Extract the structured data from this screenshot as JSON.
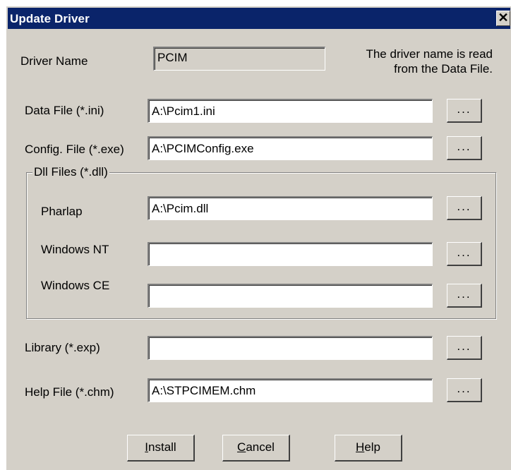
{
  "window": {
    "title": "Update Driver",
    "close_glyph": "✕"
  },
  "driver_name": {
    "label": "Driver Name",
    "value": "PCIM",
    "note_line1": "The driver name is read",
    "note_line2": "from the Data File."
  },
  "data_file": {
    "label": "Data File (*.ini)",
    "value": "A:\\Pcim1.ini"
  },
  "config_file": {
    "label": "Config. File (*.exe)",
    "value": "A:\\PCIMConfig.exe"
  },
  "dll_group": {
    "legend": "Dll Files (*.dll)",
    "pharlap": {
      "label": "Pharlap",
      "value": "A:\\Pcim.dll"
    },
    "windows_nt": {
      "label": "Windows NT",
      "value": ""
    },
    "windows_ce": {
      "label": "Windows CE",
      "value": ""
    }
  },
  "library": {
    "label": "Library (*.exp)",
    "value": ""
  },
  "help_file": {
    "label": "Help File (*.chm)",
    "value": "A:\\STPCIMEM.chm"
  },
  "browse_label": "...",
  "buttons": {
    "install": {
      "mnemonic": "I",
      "rest": "nstall"
    },
    "cancel": {
      "mnemonic": "C",
      "rest": "ancel"
    },
    "help": {
      "mnemonic": "H",
      "rest": "elp"
    }
  }
}
